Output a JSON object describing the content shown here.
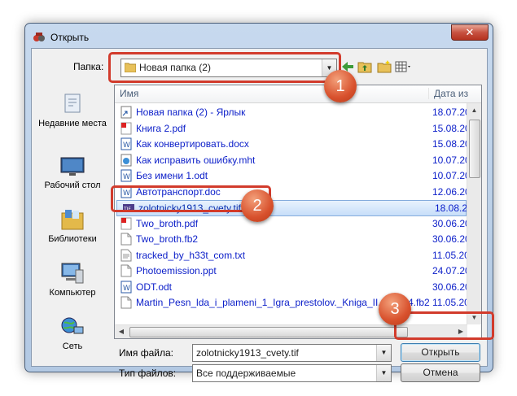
{
  "window": {
    "title": "Открыть"
  },
  "toolbar": {
    "folder_label": "Папка:",
    "folder_value": "Новая папка (2)"
  },
  "places": [
    {
      "label": "Недавние места",
      "icon": "recent-places-icon"
    },
    {
      "label": "Рабочий стол",
      "icon": "desktop-icon"
    },
    {
      "label": "Библиотеки",
      "icon": "libraries-icon"
    },
    {
      "label": "Компьютер",
      "icon": "computer-icon"
    },
    {
      "label": "Сеть",
      "icon": "network-icon"
    }
  ],
  "list": {
    "col_name": "Имя",
    "col_date": "Дата из",
    "files": [
      {
        "name": "Новая папка (2) - Ярлык",
        "date": "18.07.20",
        "icon": "shortcut-icon"
      },
      {
        "name": "Книга 2.pdf",
        "date": "15.08.20",
        "icon": "pdf-icon"
      },
      {
        "name": "Как конвертировать.docx",
        "date": "15.08.20",
        "icon": "word-icon"
      },
      {
        "name": "Как исправить ошибку.mht",
        "date": "10.07.20",
        "icon": "mht-icon"
      },
      {
        "name": "Без имени 1.odt",
        "date": "10.07.20",
        "icon": "odt-icon"
      },
      {
        "name": "Автотранспорт.doc",
        "date": "12.06.20",
        "icon": "word-icon"
      },
      {
        "name": "zolotnicky1913_cvety.tif",
        "date": "18.08.20",
        "icon": "tif-icon",
        "selected": true
      },
      {
        "name": "Two_broth.pdf",
        "date": "30.06.20",
        "icon": "pdf-icon"
      },
      {
        "name": "Two_broth.fb2",
        "date": "30.06.20",
        "icon": "file-icon"
      },
      {
        "name": "tracked_by_h33t_com.txt",
        "date": "11.05.20",
        "icon": "txt-icon"
      },
      {
        "name": "Photoemission.ppt",
        "date": "24.07.20",
        "icon": "file-icon"
      },
      {
        "name": "ODT.odt",
        "date": "30.06.20",
        "icon": "odt-icon"
      },
      {
        "name": "Martin_Pesn_lda_i_plameni_1_Igra_prestolov._Kniga_II.147364.fb2",
        "date": "11.05.20",
        "icon": "file-icon"
      }
    ]
  },
  "bottom": {
    "filename_label": "Имя файла:",
    "filename_value": "zolotnicky1913_cvety.tif",
    "filetype_label": "Тип файлов:",
    "filetype_value": "Все поддерживаемые",
    "open_label": "Открыть",
    "cancel_label": "Отмена"
  },
  "badges": [
    "1",
    "2",
    "3"
  ],
  "colors": {
    "badge": "#d8512d",
    "highlight_box": "#d23b2c",
    "link_text": "#0b1ec9"
  }
}
